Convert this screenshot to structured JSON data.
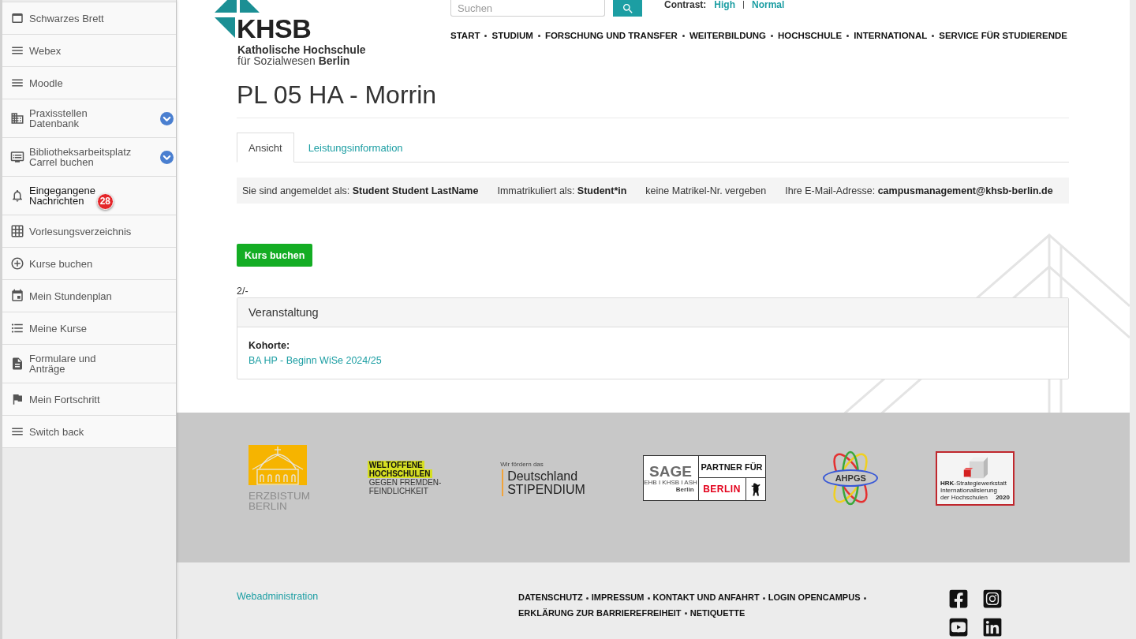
{
  "sidebar": {
    "items": [
      {
        "label": "Schwarzes Brett",
        "expandable": false,
        "highlighted": false
      },
      {
        "label": "Webex",
        "expandable": false,
        "highlighted": false
      },
      {
        "label": "Moodle",
        "expandable": false,
        "highlighted": false
      },
      {
        "label": "Praxisstellen\nDatenbank",
        "expandable": true,
        "highlighted": false
      },
      {
        "label": "Bibliotheksarbeitsplatz\nCarrel buchen",
        "expandable": true,
        "highlighted": false
      },
      {
        "label": "Eingegangene\nNachrichten",
        "expandable": false,
        "highlighted": true,
        "badge": "28"
      },
      {
        "label": "Vorlesungsverzeichnis",
        "expandable": false,
        "highlighted": false
      },
      {
        "label": "Kurse buchen",
        "expandable": false,
        "highlighted": false
      },
      {
        "label": "Mein Stundenplan",
        "expandable": false,
        "highlighted": false
      },
      {
        "label": "Meine Kurse",
        "expandable": false,
        "highlighted": false
      },
      {
        "label": "Formulare und\nAnträge",
        "expandable": false,
        "highlighted": false
      },
      {
        "label": "Mein Fortschritt",
        "expandable": false,
        "highlighted": false
      },
      {
        "label": "Switch back",
        "expandable": false,
        "highlighted": false
      }
    ]
  },
  "header": {
    "logo": {
      "name": "KHSB",
      "title_line": "Katholische Hochschule",
      "subtitle": "für Sozialwesen **Berlin**"
    },
    "search": {
      "placeholder": "Suchen"
    },
    "contrast": {
      "label": "Contrast:",
      "options": [
        "High",
        "Normal"
      ]
    },
    "nav": [
      "START",
      "STUDIUM",
      "FORSCHUNG UND TRANSFER",
      "WEITERBILDUNG",
      "HOCHSCHULE",
      "INTERNATIONAL",
      "SERVICE FÜR STUDIERENDE"
    ]
  },
  "page": {
    "title": "PL 05 HA - Morrin",
    "tabs": [
      {
        "label": "Ansicht",
        "selected": true
      },
      {
        "label": "Leistungsinformation",
        "selected": false
      }
    ],
    "user_info": [
      {
        "label": "Sie sind angemeldet als:",
        "value": "Student Student LastName"
      },
      {
        "label": "Immatrikuliert als:",
        "value": "Student*in"
      },
      {
        "label": "keine Matrikel-Nr. vergeben"
      },
      {
        "label": "Ihre E-Mail-Adresse:",
        "value": "campusmanagement@khsb-berlin.de"
      }
    ],
    "book_button": "Kurs buchen",
    "counter": "2/-",
    "panel": {
      "title": "Veranstaltung",
      "field_label": "Kohorte:",
      "link": "BA HP - Beginn WiSe 2024/25"
    }
  },
  "footer": {
    "logos": [
      {
        "kind": "erzbistum",
        "lines": [
          "ERZBISTUM",
          "BERLIN"
        ]
      },
      {
        "kind": "weltoffen",
        "lines": [
          {
            "text": "WELTOFFENE",
            "highlighted": true
          },
          {
            "text": "HOCHSCHULEN",
            "highlighted": true
          },
          {
            "text": "GEGEN FREMDEN-",
            "highlighted": false
          },
          {
            "text": "FEINDLICHKEIT",
            "highlighted": false
          }
        ]
      },
      {
        "kind": "stipendium",
        "tagline": "Wir fördern das",
        "lines": [
          "Deutschland",
          "STIPENDIUM"
        ]
      },
      {
        "kind": "partner",
        "name": "SAGE",
        "members": "EHB I KHSB I ASH",
        "city": "Berlin",
        "title": "PARTNER FÜR",
        "place": "BERLIN"
      },
      {
        "kind": "ahpgs",
        "name": "AHPGS"
      },
      {
        "kind": "hrk",
        "lines": [
          "**HRK**-Strategiewerkstatt",
          "Internationalisierung",
          "der Hochschulen"
        ],
        "year": "2020"
      }
    ],
    "admin_link": "Webadministration",
    "links": [
      "DATENSCHUTZ",
      "IMPRESSUM",
      "KONTAKT UND ANFAHRT",
      "LOGIN OPENCAMPUS",
      "ERKLÄRUNG ZUR BARRIEREFREIHEIT",
      "NETIQUETTE"
    ]
  }
}
